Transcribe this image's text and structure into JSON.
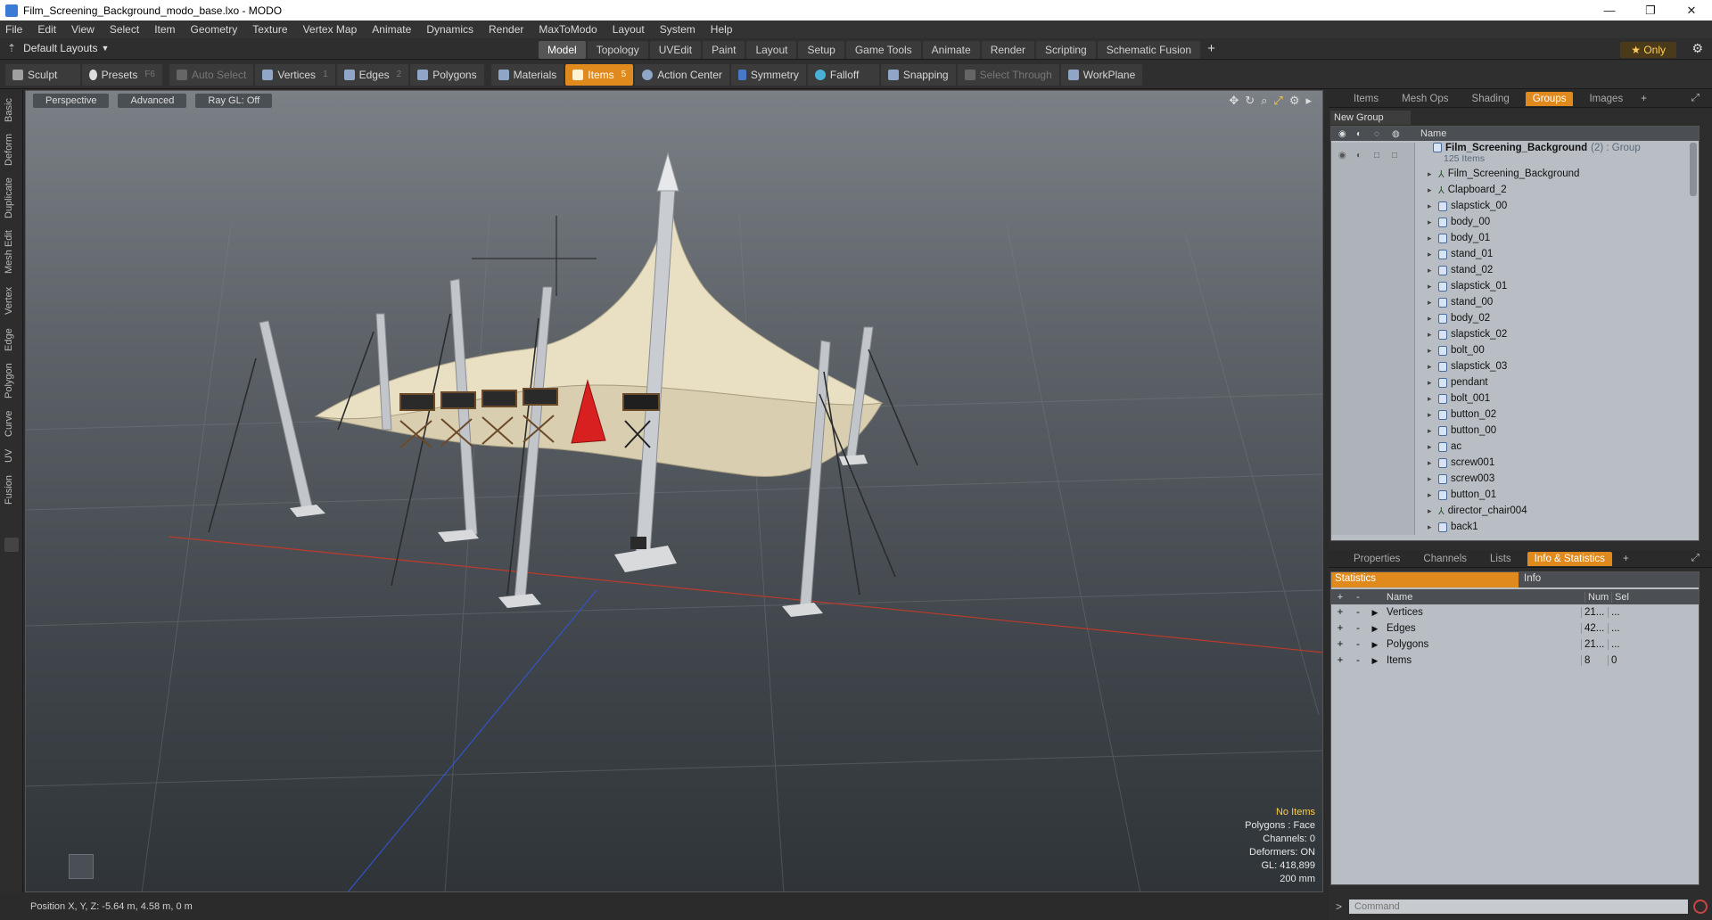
{
  "window": {
    "title": "Film_Screening_Background_modo_base.lxo - MODO",
    "controls": [
      "—",
      "❐",
      "✕"
    ]
  },
  "menu": [
    "File",
    "Edit",
    "View",
    "Select",
    "Item",
    "Geometry",
    "Texture",
    "Vertex Map",
    "Animate",
    "Dynamics",
    "Render",
    "MaxToModo",
    "Layout",
    "System",
    "Help"
  ],
  "layouts": {
    "current": "Default Layouts"
  },
  "mode_tabs": {
    "items": [
      "Model",
      "Topology",
      "UVEdit",
      "Paint",
      "Layout",
      "Setup",
      "Game Tools",
      "Animate",
      "Render",
      "Scripting",
      "Schematic Fusion"
    ],
    "active": "Model",
    "only_label": "★  Only"
  },
  "toolbar": {
    "sculpt": "Sculpt",
    "presets": "Presets",
    "presets_key": "F6",
    "auto_select": "Auto Select",
    "vertices": "Vertices",
    "vertices_key": "1",
    "edges": "Edges",
    "edges_key": "2",
    "polygons": "Polygons",
    "materials": "Materials",
    "items": "Items",
    "items_key": "5",
    "action_center": "Action Center",
    "symmetry": "Symmetry",
    "falloff": "Falloff",
    "snapping": "Snapping",
    "select_through": "Select Through",
    "workplane": "WorkPlane"
  },
  "left_tabs": [
    "Basic",
    "Deform",
    "Duplicate",
    "Mesh Edit",
    "Vertex",
    "Edge",
    "Polygon",
    "Curve",
    "UV",
    "Fusion"
  ],
  "viewport": {
    "view": "Perspective",
    "shading": "Advanced",
    "raygl": "Ray GL: Off",
    "stats": {
      "selection": "No Items",
      "polygons": "Polygons : Face",
      "channels": "Channels: 0",
      "deformers": "Deformers: ON",
      "gl": "GL: 418,899",
      "scale": "200 mm"
    }
  },
  "status": {
    "position": "Position X, Y, Z:  -5.64 m, 4.58 m, 0 m"
  },
  "right_top_tabs": {
    "items": [
      "Items",
      "Mesh Ops",
      "Shading",
      "Groups",
      "Images"
    ],
    "active": "Groups"
  },
  "groups": {
    "new_group": "New Group",
    "column_name": "Name",
    "group_name": "Film_Screening_Background",
    "group_meta": "(2) : Group",
    "group_sub": "125 Items",
    "children": [
      {
        "name": "Film_Screening_Background",
        "kind": "locator"
      },
      {
        "name": "Clapboard_2",
        "kind": "locator"
      },
      {
        "name": "slapstick_00",
        "kind": "mesh"
      },
      {
        "name": "body_00",
        "kind": "mesh"
      },
      {
        "name": "body_01",
        "kind": "mesh"
      },
      {
        "name": "stand_01",
        "kind": "mesh"
      },
      {
        "name": "stand_02",
        "kind": "mesh"
      },
      {
        "name": "slapstick_01",
        "kind": "mesh"
      },
      {
        "name": "stand_00",
        "kind": "mesh"
      },
      {
        "name": "body_02",
        "kind": "mesh"
      },
      {
        "name": "slapstick_02",
        "kind": "mesh"
      },
      {
        "name": "bolt_00",
        "kind": "mesh"
      },
      {
        "name": "slapstick_03",
        "kind": "mesh"
      },
      {
        "name": "pendant",
        "kind": "mesh"
      },
      {
        "name": "bolt_001",
        "kind": "mesh"
      },
      {
        "name": "button_02",
        "kind": "mesh"
      },
      {
        "name": "button_00",
        "kind": "mesh"
      },
      {
        "name": "ac",
        "kind": "mesh"
      },
      {
        "name": "screw001",
        "kind": "mesh"
      },
      {
        "name": "screw003",
        "kind": "mesh"
      },
      {
        "name": "button_01",
        "kind": "mesh"
      },
      {
        "name": "director_chair004",
        "kind": "locator"
      },
      {
        "name": "back1",
        "kind": "mesh"
      }
    ]
  },
  "right_bottom_tabs": {
    "items": [
      "Properties",
      "Channels",
      "Lists",
      "Info & Statistics"
    ],
    "active": "Info & Statistics"
  },
  "statistics": {
    "tab_statistics": "Statistics",
    "tab_info": "Info",
    "columns": {
      "name": "Name",
      "num": "Num",
      "sel": "Sel"
    },
    "rows": [
      {
        "name": "Vertices",
        "num": "21...",
        "sel": "..."
      },
      {
        "name": "Edges",
        "num": "42...",
        "sel": "..."
      },
      {
        "name": "Polygons",
        "num": "21...",
        "sel": "..."
      },
      {
        "name": "Items",
        "num": "8",
        "sel": "0"
      }
    ]
  },
  "command": {
    "placeholder": "Command"
  },
  "colors": {
    "accent": "#e08a1e",
    "selection_text": "#ffcf3a",
    "tent_canvas": "#e9e0c4",
    "x_axis": "#c0392b",
    "z_axis": "#3452c8"
  }
}
